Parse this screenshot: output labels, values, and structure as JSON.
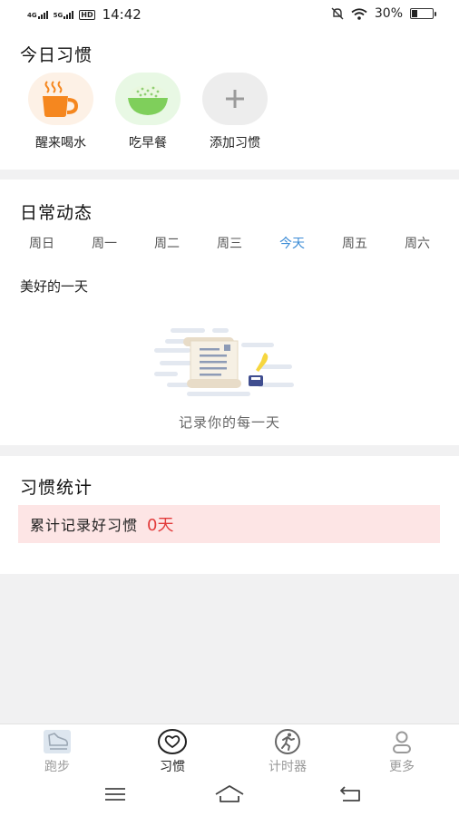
{
  "status_bar": {
    "signal1": "4G",
    "signal2": "5G",
    "hd": "HD",
    "time": "14:42",
    "battery_text": "30%",
    "battery_level": 0.3
  },
  "today_habits": {
    "title": "今日习惯",
    "items": [
      {
        "label": "醒来喝水",
        "icon": "cup-icon",
        "bg": "#fdf1e6"
      },
      {
        "label": "吃早餐",
        "icon": "rice-bowl-icon",
        "bg": "#e8f8e4"
      },
      {
        "label": "添加习惯",
        "icon": "plus-icon",
        "bg": "#ededed"
      }
    ]
  },
  "daily": {
    "title": "日常动态",
    "days": [
      "周日",
      "周一",
      "周二",
      "周三",
      "今天",
      "周五",
      "周六"
    ],
    "active_index": 4,
    "subtitle": "美好的一天",
    "empty_text": "记录你的每一天"
  },
  "stats": {
    "title": "习惯统计",
    "label": "累计记录好习惯",
    "value": "0天"
  },
  "tabs": [
    {
      "label": "跑步",
      "icon": "shoe-icon",
      "active": false
    },
    {
      "label": "习惯",
      "icon": "heart-icon",
      "active": true
    },
    {
      "label": "计时器",
      "icon": "runner-icon",
      "active": false
    },
    {
      "label": "更多",
      "icon": "user-icon",
      "active": false
    }
  ],
  "nav": [
    "menu-icon",
    "home-icon",
    "back-icon"
  ],
  "colors": {
    "accent_blue": "#3c8cd6",
    "stat_red": "#e23b3b",
    "stat_bg": "#fde5e5",
    "cup_orange": "#f5871f",
    "bowl_green": "#7fcf5b"
  }
}
